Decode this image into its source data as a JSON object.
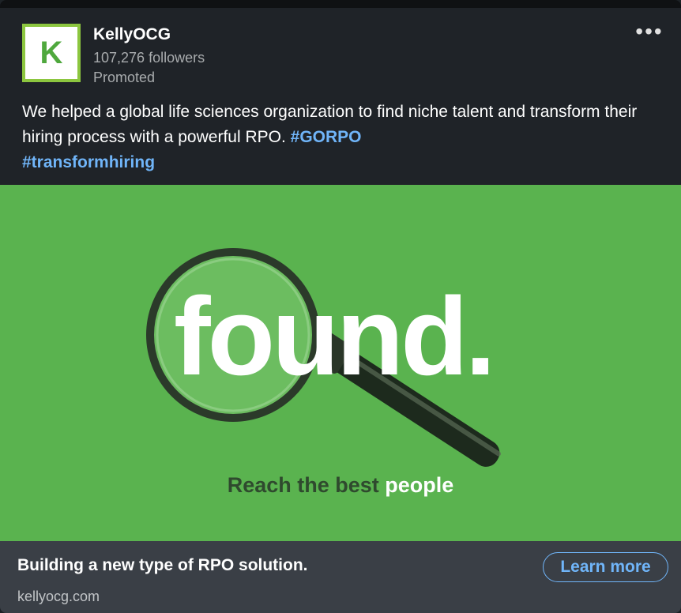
{
  "post": {
    "company": "KellyOCG",
    "logo_letter": "K",
    "followers": "107,276 followers",
    "promoted": "Promoted",
    "more_icon": "•••",
    "text": "We helped a global life sciences organization to find niche talent and transform their hiring process with a powerful RPO. ",
    "hashtags": [
      "#GORPO",
      "#transformhiring"
    ]
  },
  "ad": {
    "headline": "found.",
    "tagline_dark": "Reach the best",
    "tagline_light": "people",
    "background_color": "#5ab34f"
  },
  "footer": {
    "title": "Building a new type of RPO solution.",
    "domain": "kellyocg.com",
    "cta": "Learn more"
  },
  "colors": {
    "accent": "#70b5f9",
    "logo_border": "#8cc63f"
  }
}
